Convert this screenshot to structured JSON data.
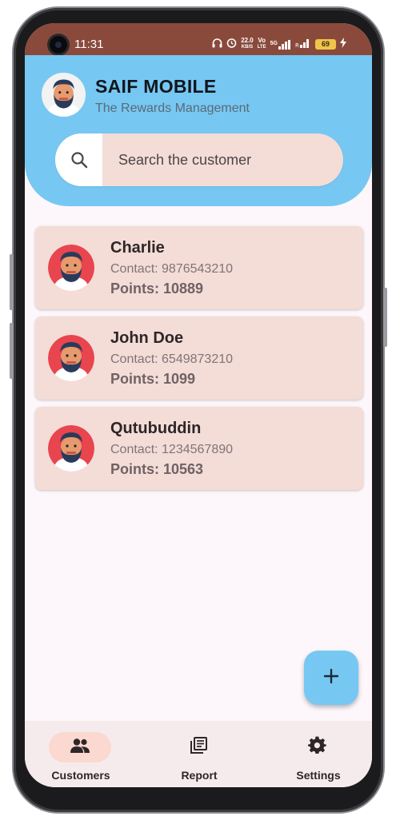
{
  "status_bar": {
    "time": "11:31",
    "net_speed_value": "22.0",
    "net_speed_unit": "KB/S",
    "volte_top": "Vo",
    "volte_bottom": "LTE",
    "network_type": "5G",
    "battery": "69"
  },
  "header": {
    "title": "SAIF MOBILE",
    "subtitle": "The Rewards Management",
    "search_placeholder": "Search the customer",
    "background_color": "#76c8f2"
  },
  "customers": [
    {
      "name": "Charlie",
      "contact": "Contact: 9876543210",
      "points": "Points: 10889"
    },
    {
      "name": "John Doe",
      "contact": "Contact: 6549873210",
      "points": "Points: 1099"
    },
    {
      "name": "Qutubuddin",
      "contact": "Contact: 1234567890",
      "points": "Points: 10563"
    }
  ],
  "fab": {
    "icon": "plus-icon"
  },
  "bottom_nav": {
    "items": [
      {
        "label": "Customers",
        "icon": "people-icon",
        "active": true
      },
      {
        "label": "Report",
        "icon": "report-icon",
        "active": false
      },
      {
        "label": "Settings",
        "icon": "gear-icon",
        "active": false
      }
    ]
  },
  "colors": {
    "accent": "#76c8f2",
    "card": "#f4dcd7",
    "status_bar": "#8a4a3b",
    "nav_active": "#fbd8d0"
  }
}
